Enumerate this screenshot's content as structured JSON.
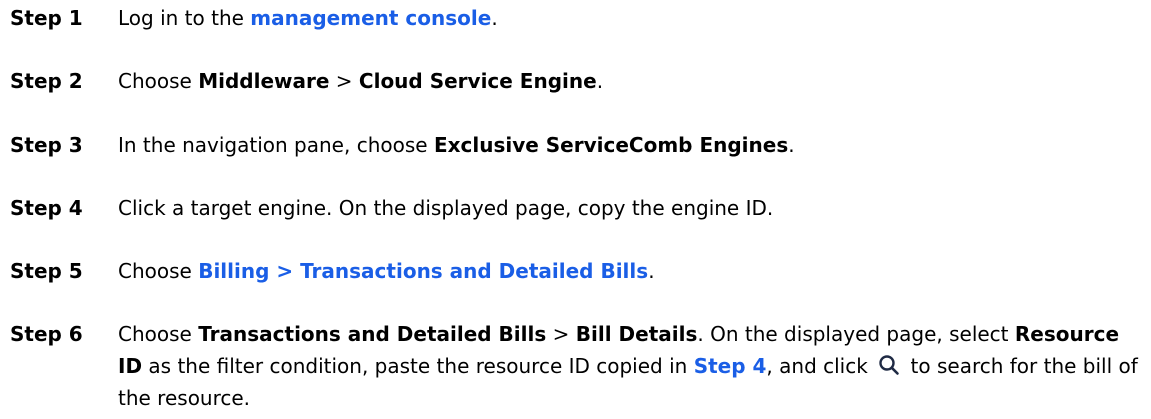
{
  "steps": [
    {
      "label": "Step 1",
      "pre": "Log in to the ",
      "link": "management console",
      "post": "."
    },
    {
      "label": "Step 2",
      "pre": "Choose ",
      "b1": "Middleware",
      "mid": " > ",
      "b2": "Cloud Service Engine",
      "post": "."
    },
    {
      "label": "Step 3",
      "pre": "In the navigation pane, choose ",
      "b1": "Exclusive ServiceComb Engines",
      "post": "."
    },
    {
      "label": "Step 4",
      "text": "Click a target engine. On the displayed page, copy the engine ID."
    },
    {
      "label": "Step 5",
      "pre": "Choose ",
      "link": "Billing > Transactions and Detailed Bills",
      "post": "."
    },
    {
      "label": "Step 6",
      "pre": "Choose ",
      "b1": "Transactions and Detailed Bills",
      "mid1": " > ",
      "b2": "Bill Details",
      "mid2": ". On the displayed page, select ",
      "b3": "Resource ID",
      "mid3": " as the filter condition, paste the resource ID copied in ",
      "link": "Step 4",
      "mid4": ", and click ",
      "icon": "search-icon",
      "post": " to search for the bill of the resource."
    }
  ]
}
